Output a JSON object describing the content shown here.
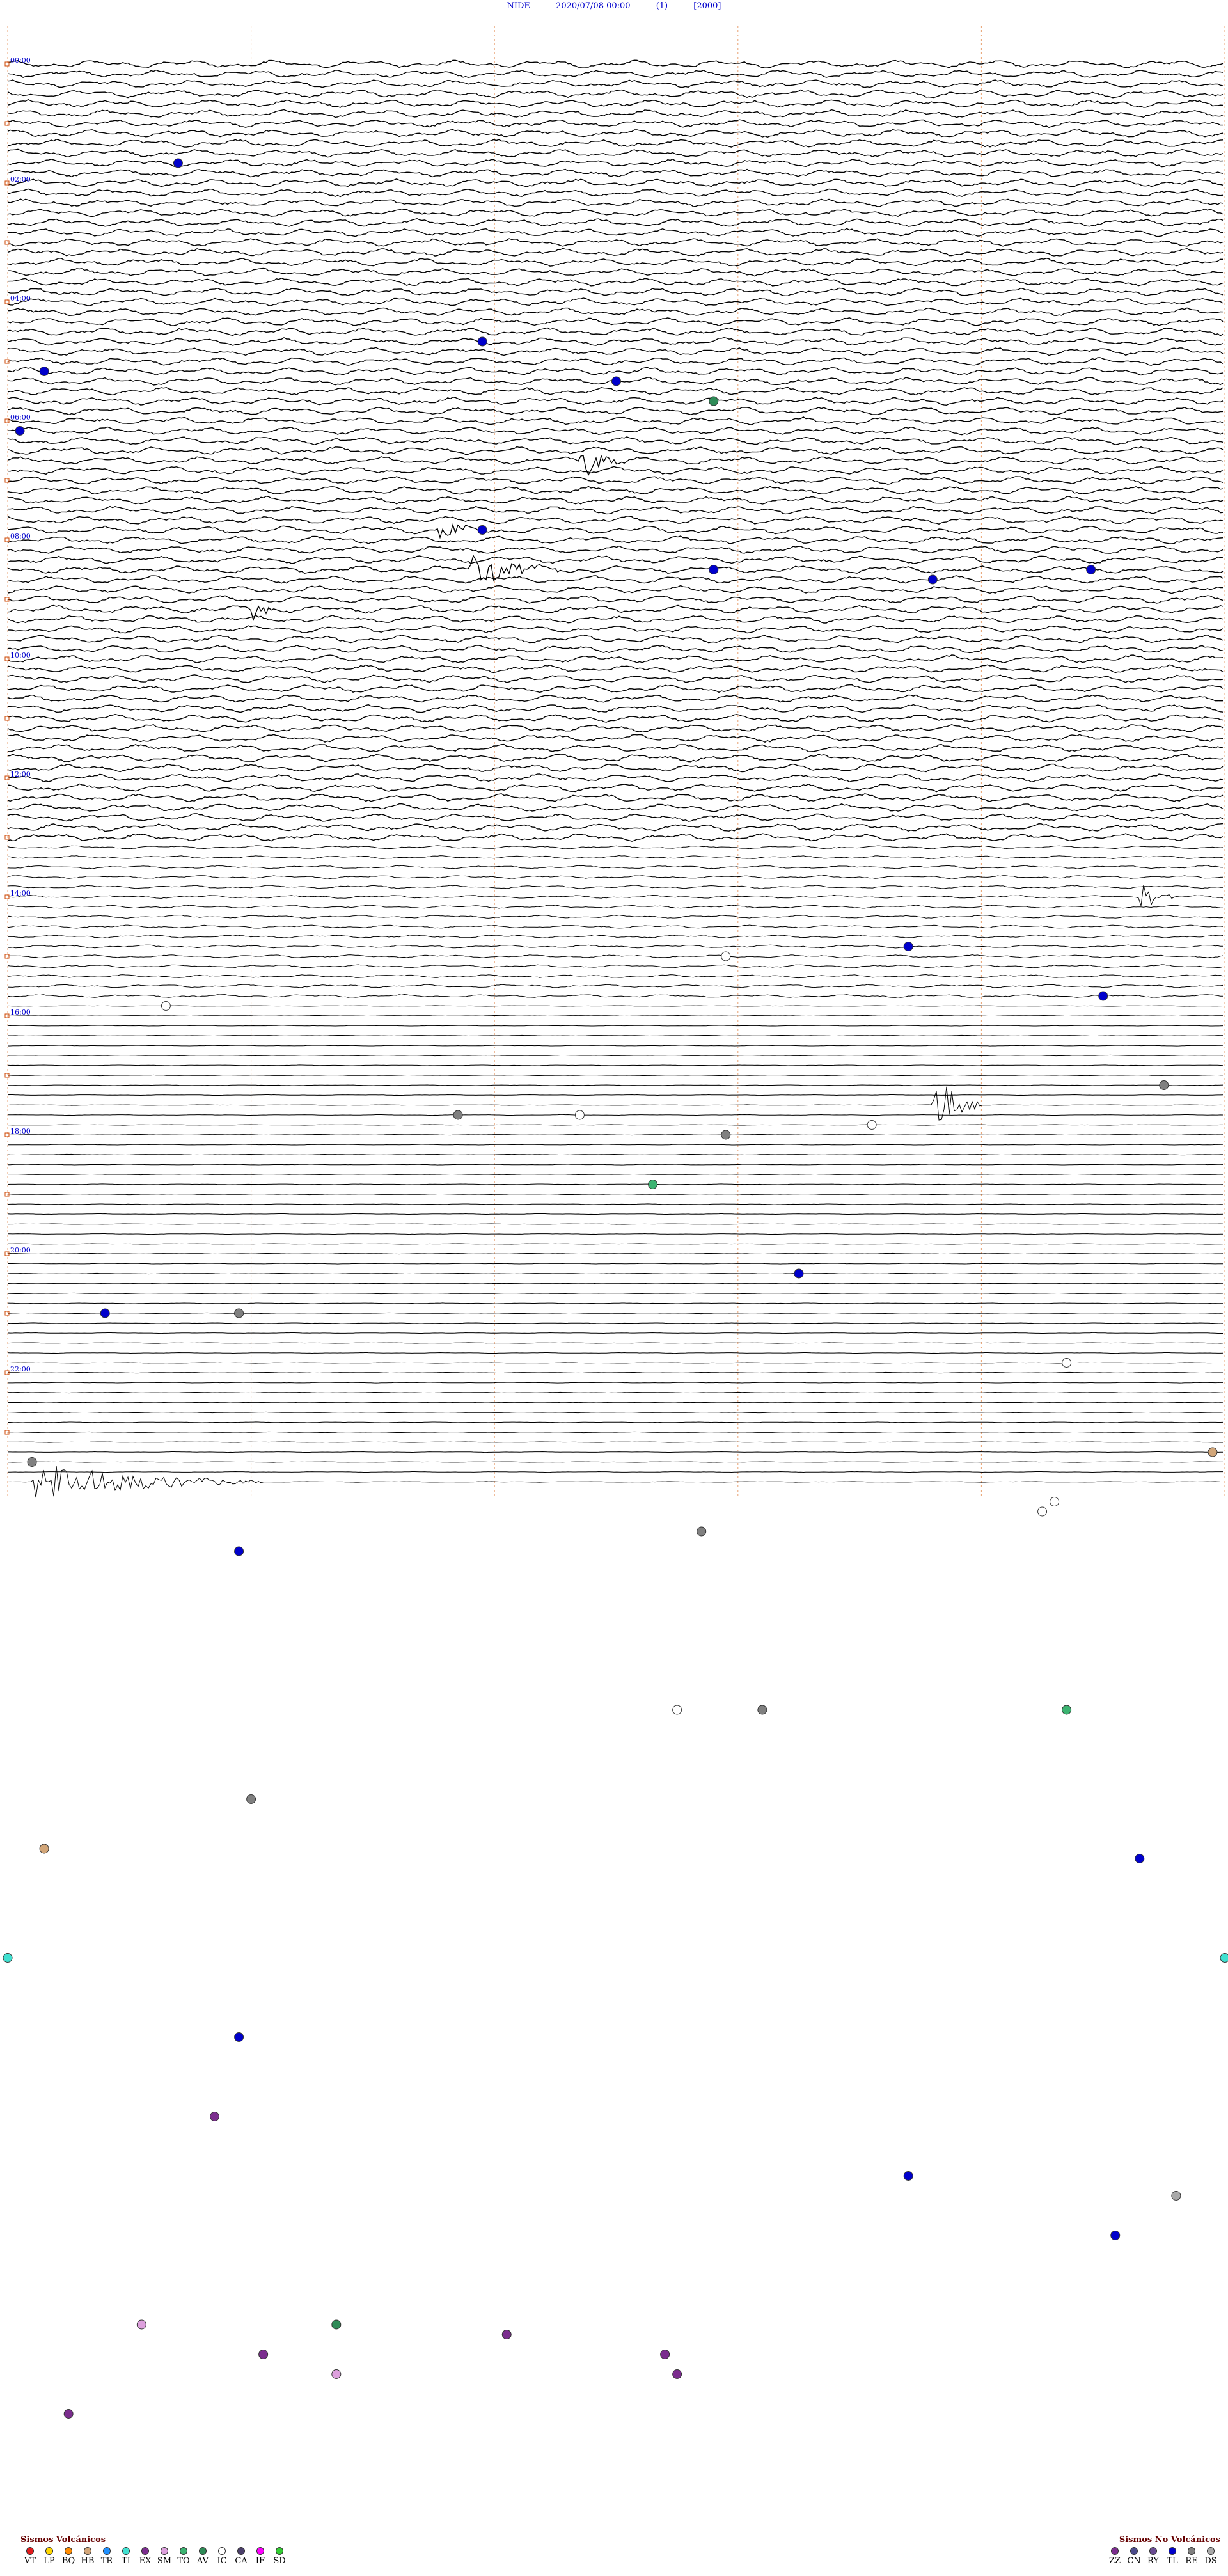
{
  "header": {
    "station": "NIDE",
    "datetime": "2020/07/08 00:00",
    "component": "(1)",
    "scale": "[2000]"
  },
  "chart_data": {
    "type": "helicorder",
    "title": "NIDE 2020/07/08 00:00 (1) [2000]",
    "start_datetime": "2020/07/08 00:00",
    "lines_per_hour": 6,
    "hours": 24,
    "minutes_per_line": 10,
    "hour_labels": [
      "00:00",
      "02:00",
      "04:00",
      "06:00",
      "08:00",
      "10:00",
      "12:00",
      "14:00",
      "16:00",
      "18:00",
      "20:00",
      "22:00"
    ],
    "minute_marks": [
      0,
      2,
      4,
      6,
      8,
      10
    ],
    "noise_profile": [
      {
        "from_line": 0,
        "to_line": 78,
        "level": 0.85
      },
      {
        "from_line": 79,
        "to_line": 94,
        "level": 0.35
      },
      {
        "from_line": 95,
        "to_line": 162,
        "level": 0.08
      },
      {
        "from_line": 163,
        "to_line": 186,
        "level": 0.45
      },
      {
        "from_line": 187,
        "to_line": 222,
        "level": 0.9
      },
      {
        "from_line": 223,
        "to_line": 240,
        "level": 0.85
      }
    ],
    "bursts": [
      {
        "line": 40,
        "minute": 4.7,
        "length_min": 0.4,
        "amp": 2.2
      },
      {
        "line": 47,
        "minute": 3.5,
        "length_min": 0.4,
        "amp": 1.2
      },
      {
        "line": 51,
        "minute": 3.8,
        "length_min": 0.9,
        "amp": 1.5
      },
      {
        "line": 55,
        "minute": 2.0,
        "length_min": 0.2,
        "amp": 1.3
      },
      {
        "line": 84,
        "minute": 9.3,
        "length_min": 0.3,
        "amp": 2.0
      },
      {
        "line": 105,
        "minute": 7.6,
        "length_min": 0.4,
        "amp": 4.0
      },
      {
        "line": 143,
        "minute": 0.2,
        "length_min": 1.9,
        "amp": 2.4
      },
      {
        "line": 177,
        "minute": 2.1,
        "length_min": 2.0,
        "amp": 2.0
      },
      {
        "line": 215,
        "minute": 0.0,
        "length_min": 10.0,
        "amp": 1.6
      },
      {
        "line": 219,
        "minute": 7.4,
        "length_min": 2.6,
        "amp": 2.0
      }
    ],
    "events": [
      {
        "line": 10,
        "minute": 1.4,
        "class": "TL"
      },
      {
        "line": 28,
        "minute": 3.9,
        "class": "TL"
      },
      {
        "line": 31,
        "minute": 0.3,
        "class": "TL"
      },
      {
        "line": 32,
        "minute": 5.0,
        "class": "TL"
      },
      {
        "line": 34,
        "minute": 5.8,
        "class": "AV"
      },
      {
        "line": 37,
        "minute": 0.1,
        "class": "TL"
      },
      {
        "line": 47,
        "minute": 3.9,
        "class": "TL"
      },
      {
        "line": 51,
        "minute": 5.8,
        "class": "TL"
      },
      {
        "line": 51,
        "minute": 8.9,
        "class": "TL"
      },
      {
        "line": 52,
        "minute": 7.6,
        "class": "TL"
      },
      {
        "line": 89,
        "minute": 7.4,
        "class": "TL"
      },
      {
        "line": 90,
        "minute": 5.9,
        "class": "IC"
      },
      {
        "line": 94,
        "minute": 9.0,
        "class": "TL"
      },
      {
        "line": 95,
        "minute": 1.3,
        "class": "IC"
      },
      {
        "line": 103,
        "minute": 9.5,
        "class": "RE"
      },
      {
        "line": 106,
        "minute": 3.7,
        "class": "RE"
      },
      {
        "line": 106,
        "minute": 4.7,
        "class": "IC"
      },
      {
        "line": 107,
        "minute": 7.1,
        "class": "IC"
      },
      {
        "line": 108,
        "minute": 5.9,
        "class": "RE"
      },
      {
        "line": 113,
        "minute": 5.3,
        "class": "TO"
      },
      {
        "line": 122,
        "minute": 6.5,
        "class": "TL"
      },
      {
        "line": 126,
        "minute": 0.8,
        "class": "TL"
      },
      {
        "line": 126,
        "minute": 1.9,
        "class": "RE"
      },
      {
        "line": 131,
        "minute": 8.7,
        "class": "IC"
      },
      {
        "line": 140,
        "minute": 9.9,
        "class": "HB"
      },
      {
        "line": 141,
        "minute": 0.2,
        "class": "RE"
      },
      {
        "line": 145,
        "minute": 8.6,
        "class": "IC"
      },
      {
        "line": 146,
        "minute": 8.5,
        "class": "IC"
      },
      {
        "line": 148,
        "minute": 5.7,
        "class": "RE"
      },
      {
        "line": 150,
        "minute": 1.9,
        "class": "TL"
      },
      {
        "line": 166,
        "minute": 5.5,
        "class": "IC"
      },
      {
        "line": 166,
        "minute": 6.2,
        "class": "RE"
      },
      {
        "line": 166,
        "minute": 8.7,
        "class": "TO"
      },
      {
        "line": 175,
        "minute": 2.0,
        "class": "RE"
      },
      {
        "line": 180,
        "minute": 0.3,
        "class": "HB"
      },
      {
        "line": 181,
        "minute": 9.3,
        "class": "TL"
      },
      {
        "line": 191,
        "minute": 0.0,
        "class": "TI"
      },
      {
        "line": 191,
        "minute": 10.0,
        "class": "TI"
      },
      {
        "line": 199,
        "minute": 1.9,
        "class": "TL"
      },
      {
        "line": 207,
        "minute": 1.7,
        "class": "EX"
      },
      {
        "line": 213,
        "minute": 7.4,
        "class": "TL"
      },
      {
        "line": 215,
        "minute": 9.6,
        "class": "DS"
      },
      {
        "line": 219,
        "minute": 9.1,
        "class": "TL"
      },
      {
        "line": 228,
        "minute": 1.1,
        "class": "SM"
      },
      {
        "line": 228,
        "minute": 2.7,
        "class": "AV"
      },
      {
        "line": 229,
        "minute": 4.1,
        "class": "EX"
      },
      {
        "line": 231,
        "minute": 2.1,
        "class": "EX"
      },
      {
        "line": 231,
        "minute": 5.4,
        "class": "EX"
      },
      {
        "line": 233,
        "minute": 2.7,
        "class": "SM"
      },
      {
        "line": 233,
        "minute": 5.5,
        "class": "EX"
      },
      {
        "line": 237,
        "minute": 0.5,
        "class": "EX"
      }
    ]
  },
  "legend_volcanic": {
    "title": "Sismos Volcánicos",
    "items": [
      {
        "code": "VT",
        "color": "#e31a1c"
      },
      {
        "code": "LP",
        "color": "#ffd700"
      },
      {
        "code": "BQ",
        "color": "#ff8c00"
      },
      {
        "code": "HB",
        "color": "#d2a679"
      },
      {
        "code": "TR",
        "color": "#1e90ff"
      },
      {
        "code": "TI",
        "color": "#40e0d0"
      },
      {
        "code": "EX",
        "color": "#7b2d8e"
      },
      {
        "code": "SM",
        "color": "#dda0dd"
      },
      {
        "code": "TO",
        "color": "#3cb371"
      },
      {
        "code": "AV",
        "color": "#2e8b57"
      },
      {
        "code": "IC",
        "color": "#ffffff"
      },
      {
        "code": "CA",
        "color": "#4b3f6b"
      },
      {
        "code": "IF",
        "color": "#ff00ff"
      },
      {
        "code": "SD",
        "color": "#32cd32"
      }
    ]
  },
  "legend_nonvolcanic": {
    "title": "Sismos No Volcánicos",
    "items": [
      {
        "code": "ZZ",
        "color": "#7b2d8e"
      },
      {
        "code": "CN",
        "color": "#4b4b8b"
      },
      {
        "code": "RY",
        "color": "#6a4c93"
      },
      {
        "code": "TL",
        "color": "#0000cc"
      },
      {
        "code": "RE",
        "color": "#808080"
      },
      {
        "code": "DS",
        "color": "#a9a9a9"
      }
    ]
  }
}
